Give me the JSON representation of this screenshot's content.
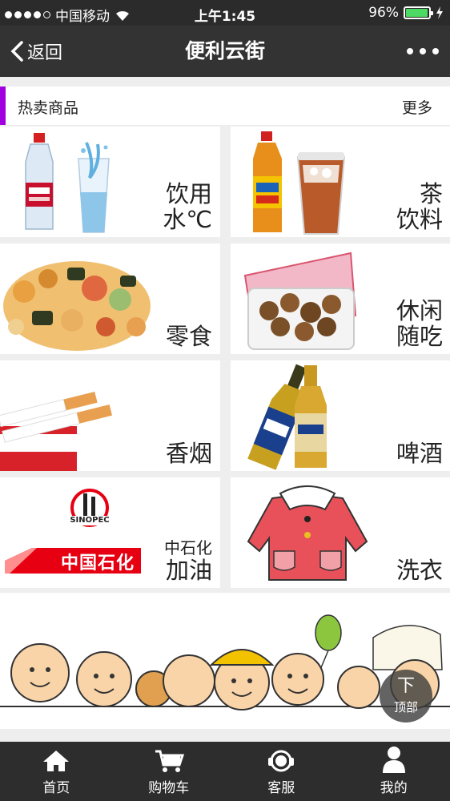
{
  "status": {
    "carrier": "中国移动",
    "time": "上午1:45",
    "battery": "96%",
    "battery_level": 0.96
  },
  "nav": {
    "back_label": "返回",
    "title": "便利云街"
  },
  "section": {
    "title": "热卖商品",
    "more": "更多"
  },
  "tiles": [
    {
      "line1": "饮用",
      "line2": "水℃",
      "icon": "water-bottle-icon"
    },
    {
      "line1": "茶",
      "line2": "饮料",
      "icon": "tea-drink-icon"
    },
    {
      "line1": "",
      "line2": "零食",
      "icon": "snacks-icon"
    },
    {
      "line1": "休闲",
      "line2": "随吃",
      "icon": "casual-snack-icon"
    },
    {
      "line1": "",
      "line2": "香烟",
      "icon": "cigarette-icon"
    },
    {
      "line1": "",
      "line2": "啤酒",
      "icon": "beer-icon"
    },
    {
      "line1": "中石化",
      "line2": "加油",
      "icon": "sinopec-icon",
      "logo_text": "中国石化",
      "brand": "SINOPEC"
    },
    {
      "line1": "",
      "line2": "洗衣",
      "icon": "laundry-icon"
    }
  ],
  "to_top": {
    "arrow": "下",
    "label": "顶部"
  },
  "tabs": [
    {
      "label": "首页",
      "icon": "home-icon"
    },
    {
      "label": "购物车",
      "icon": "cart-icon"
    },
    {
      "label": "客服",
      "icon": "headset-icon"
    },
    {
      "label": "我的",
      "icon": "user-icon"
    }
  ],
  "colors": {
    "accent": "#a000e0",
    "nav_bg": "#333333",
    "tab_bg": "#2d2d2d",
    "battery_green": "#4cd964",
    "sinopec_red": "#e60012"
  }
}
